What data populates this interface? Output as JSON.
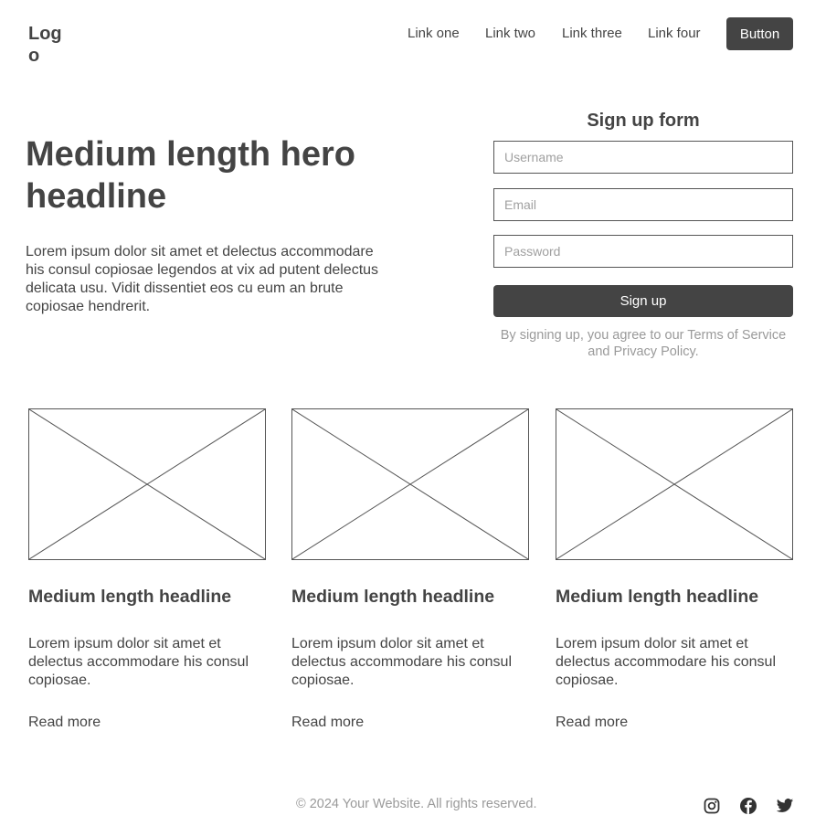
{
  "header": {
    "logo": "Logo",
    "nav": [
      "Link one",
      "Link two",
      "Link three",
      "Link four"
    ],
    "button": "Button"
  },
  "hero": {
    "title": "Medium length hero headline",
    "text": "Lorem ipsum dolor sit amet et delectus accommodare his consul copiosae legendos at vix ad putent delectus delicata usu. Vidit dissentiet eos cu eum an brute copiosae hendrerit."
  },
  "form": {
    "title": "Sign up form",
    "username_placeholder": "Username",
    "email_placeholder": "Email",
    "password_placeholder": "Password",
    "submit": "Sign up",
    "terms": "By signing up, you agree to our Terms of Service and Privacy Policy."
  },
  "cards": [
    {
      "title": "Medium length headline",
      "text": "Lorem ipsum dolor sit amet et delectus accommodare his consul copiosae.",
      "link": "Read more"
    },
    {
      "title": "Medium length headline",
      "text": "Lorem ipsum dolor sit amet et delectus accommodare his consul copiosae.",
      "link": "Read more"
    },
    {
      "title": "Medium length headline",
      "text": "Lorem ipsum dolor sit amet et delectus accommodare his consul copiosae.",
      "link": "Read more"
    }
  ],
  "footer": {
    "copyright": "© 2024 Your Website. All rights reserved.",
    "social": [
      "instagram-icon",
      "facebook-icon",
      "twitter-icon"
    ]
  },
  "colors": {
    "primary": "#444444",
    "muted": "#9a9a9a",
    "background": "#ffffff"
  }
}
